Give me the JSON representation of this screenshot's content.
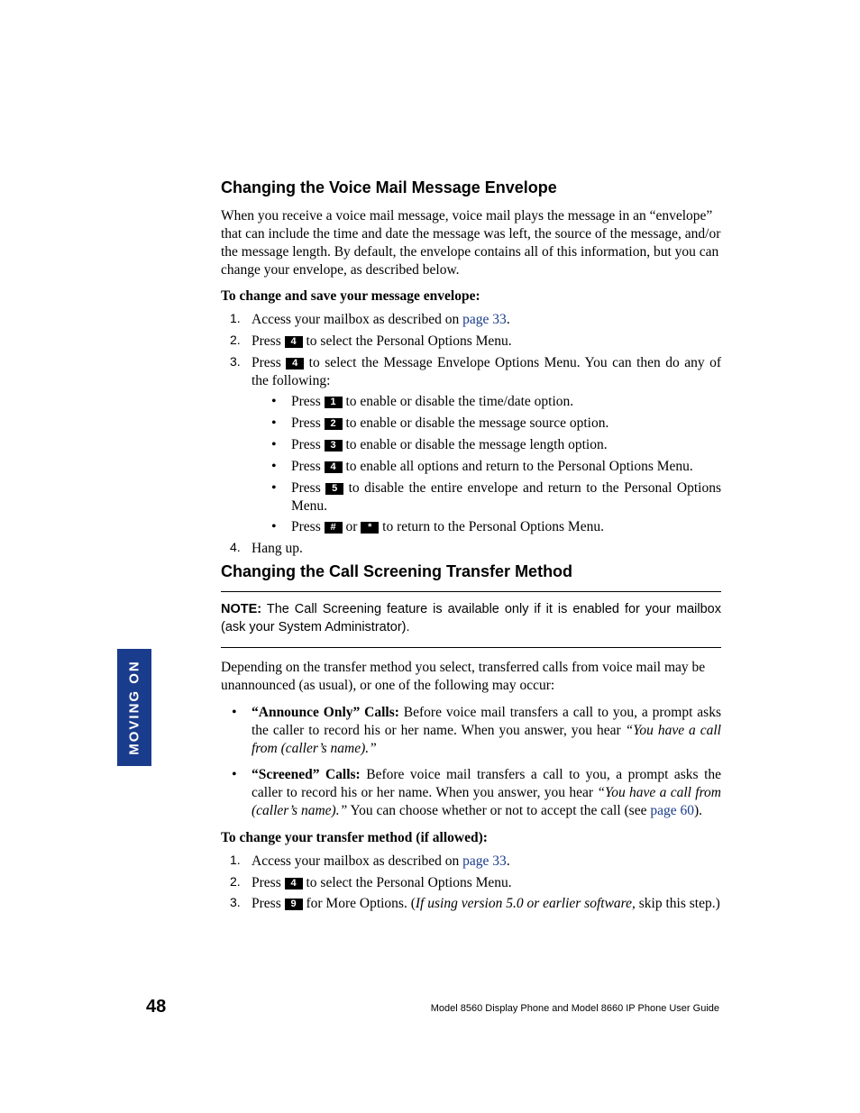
{
  "sideTab": "MOVING ON",
  "pageNumber": "48",
  "footer": "Model 8560 Display Phone and Model 8660 IP Phone User Guide",
  "section1": {
    "heading": "Changing the Voice Mail Message Envelope",
    "intro": "When you receive a voice mail message, voice mail plays the message in an “envelope” that can include the time and date the message was left, the source of the message, and/or the message length. By default, the envelope contains all of this information, but you can change your envelope, as described below.",
    "procTitle": "To change and save your message envelope:",
    "steps": {
      "s1a": "Access your mailbox as described on ",
      "s1link": "page 33",
      "s1b": ".",
      "s2a": "Press ",
      "s2key": "4",
      "s2b": " to select the Personal Options Menu.",
      "s3a": "Press ",
      "s3key": "4",
      "s3b": " to select the Message Envelope Options Menu. You can then do any of the following:",
      "s4": "Hang up."
    },
    "sub": {
      "b1a": "Press ",
      "b1key": "1",
      "b1b": " to enable or disable the time/date option.",
      "b2a": "Press ",
      "b2key": "2",
      "b2b": " to enable or disable the message source option.",
      "b3a": "Press ",
      "b3key": "3",
      "b3b": " to enable or disable the message length option.",
      "b4a": "Press ",
      "b4key": "4",
      "b4b": " to enable all options and return to the Personal Options Menu.",
      "b5a": "Press ",
      "b5key": "5",
      "b5b": " to disable the entire envelope and return to the Personal Options Menu.",
      "b6a": "Press ",
      "b6key1": "#",
      "b6mid": " or ",
      "b6key2": "*",
      "b6b": " to return to the Personal Options Menu."
    }
  },
  "section2": {
    "heading": "Changing the Call Screening Transfer Method",
    "noteLabel": "NOTE:",
    "noteText": " The Call Screening feature is available only if it is enabled for your mailbox (ask your System Administrator).",
    "intro": "Depending on the transfer method you select, transferred calls from voice mail may be unannounced (as usual), or one of the following may occur:",
    "d1bold": "“Announce Only” Calls:",
    "d1a": " Before voice mail transfers a call to you, a prompt asks the caller to record his or her name. When you answer, you hear ",
    "d1i": "“You have a call from (caller’s name).”",
    "d2bold": "“Screened” Calls:",
    "d2a": " Before voice mail transfers a call to you, a prompt asks the caller to record his or her name. When you answer, you hear ",
    "d2i": "“You have a call from (caller’s name).”",
    "d2b": " You can choose whether or not to accept the call (see ",
    "d2link": "page 60",
    "d2c": ").",
    "procTitle": "To change your transfer method (if allowed):",
    "steps": {
      "s1a": "Access your mailbox as described on ",
      "s1link": "page 33",
      "s1b": ".",
      "s2a": "Press ",
      "s2key": "4",
      "s2b": " to select the Personal Options Menu.",
      "s3a": "Press ",
      "s3key": "9",
      "s3b": " for More Options. (",
      "s3i": "If using version 5.0 or earlier software,",
      "s3c": " skip this step.)"
    }
  }
}
